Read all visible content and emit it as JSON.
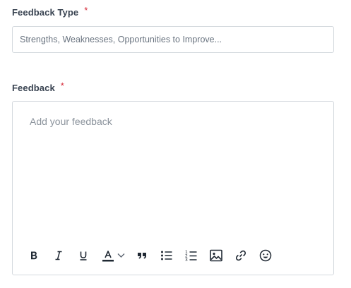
{
  "feedback_type": {
    "label": "Feedback Type",
    "required_marker": "*",
    "placeholder": "Strengths, Weaknesses, Opportunities to Improve...",
    "value": ""
  },
  "feedback": {
    "label": "Feedback",
    "required_marker": "*",
    "placeholder": "Add your feedback",
    "value": ""
  },
  "toolbar": {
    "buttons": [
      "bold-icon",
      "italic-icon",
      "underline-icon",
      "text-color-icon",
      "chevron-down-icon",
      "blockquote-icon",
      "bulleted-list-icon",
      "numbered-list-icon",
      "image-icon",
      "link-icon",
      "emoji-icon"
    ],
    "text_color": "#1f2833"
  },
  "colors": {
    "required": "#d62b3a",
    "border": "#d4d9de",
    "placeholder": "#8b939c"
  }
}
